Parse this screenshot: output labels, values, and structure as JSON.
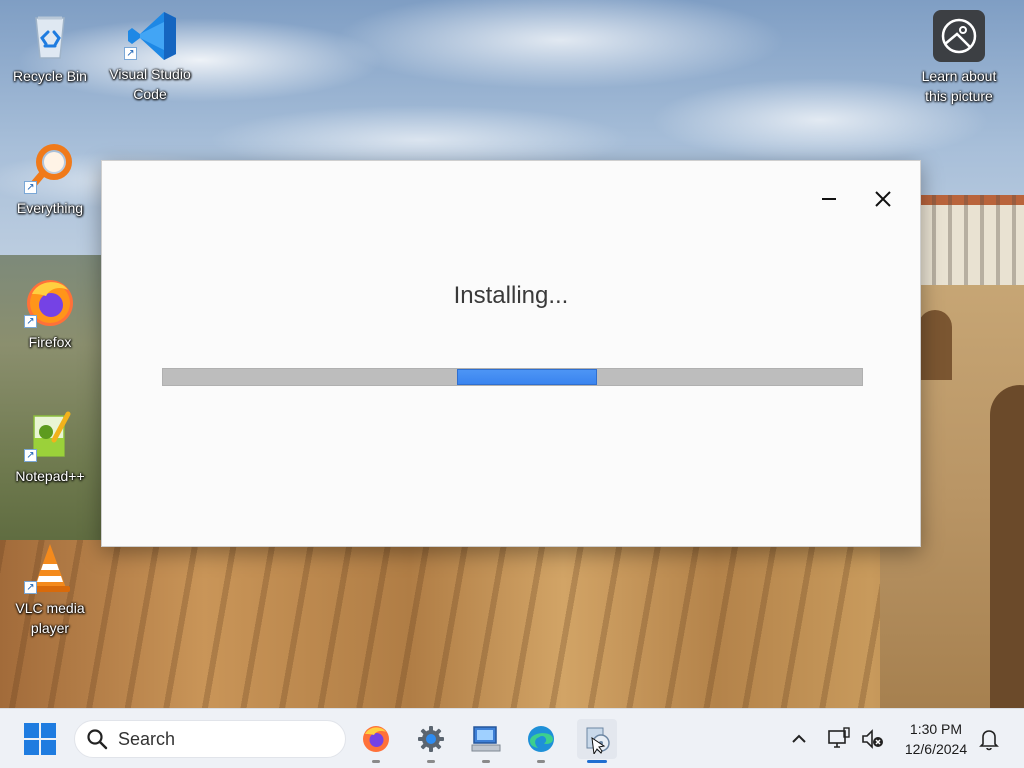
{
  "desktop": {
    "icons": [
      {
        "id": "recycle-bin",
        "label": "Recycle Bin"
      },
      {
        "id": "vscode",
        "label": "Visual Studio Code"
      },
      {
        "id": "everything",
        "label": "Everything"
      },
      {
        "id": "firefox",
        "label": "Firefox"
      },
      {
        "id": "notepadpp",
        "label": "Notepad++"
      },
      {
        "id": "vlc",
        "label": "VLC media player"
      },
      {
        "id": "learn-picture",
        "label": "Learn about this picture"
      }
    ]
  },
  "installer": {
    "status": "Installing...",
    "progress_style": "indeterminate-marquee",
    "accent_color": "#3a84ef"
  },
  "taskbar": {
    "search_placeholder": "Search",
    "apps": [
      {
        "id": "firefox",
        "icon": "firefox-icon"
      },
      {
        "id": "settings",
        "icon": "gear-icon"
      },
      {
        "id": "network",
        "icon": "computer-icon"
      },
      {
        "id": "edge",
        "icon": "edge-icon"
      },
      {
        "id": "installer",
        "icon": "installer-icon",
        "active": true
      }
    ],
    "tray": {
      "time": "1:30 PM",
      "date": "12/6/2024"
    }
  }
}
